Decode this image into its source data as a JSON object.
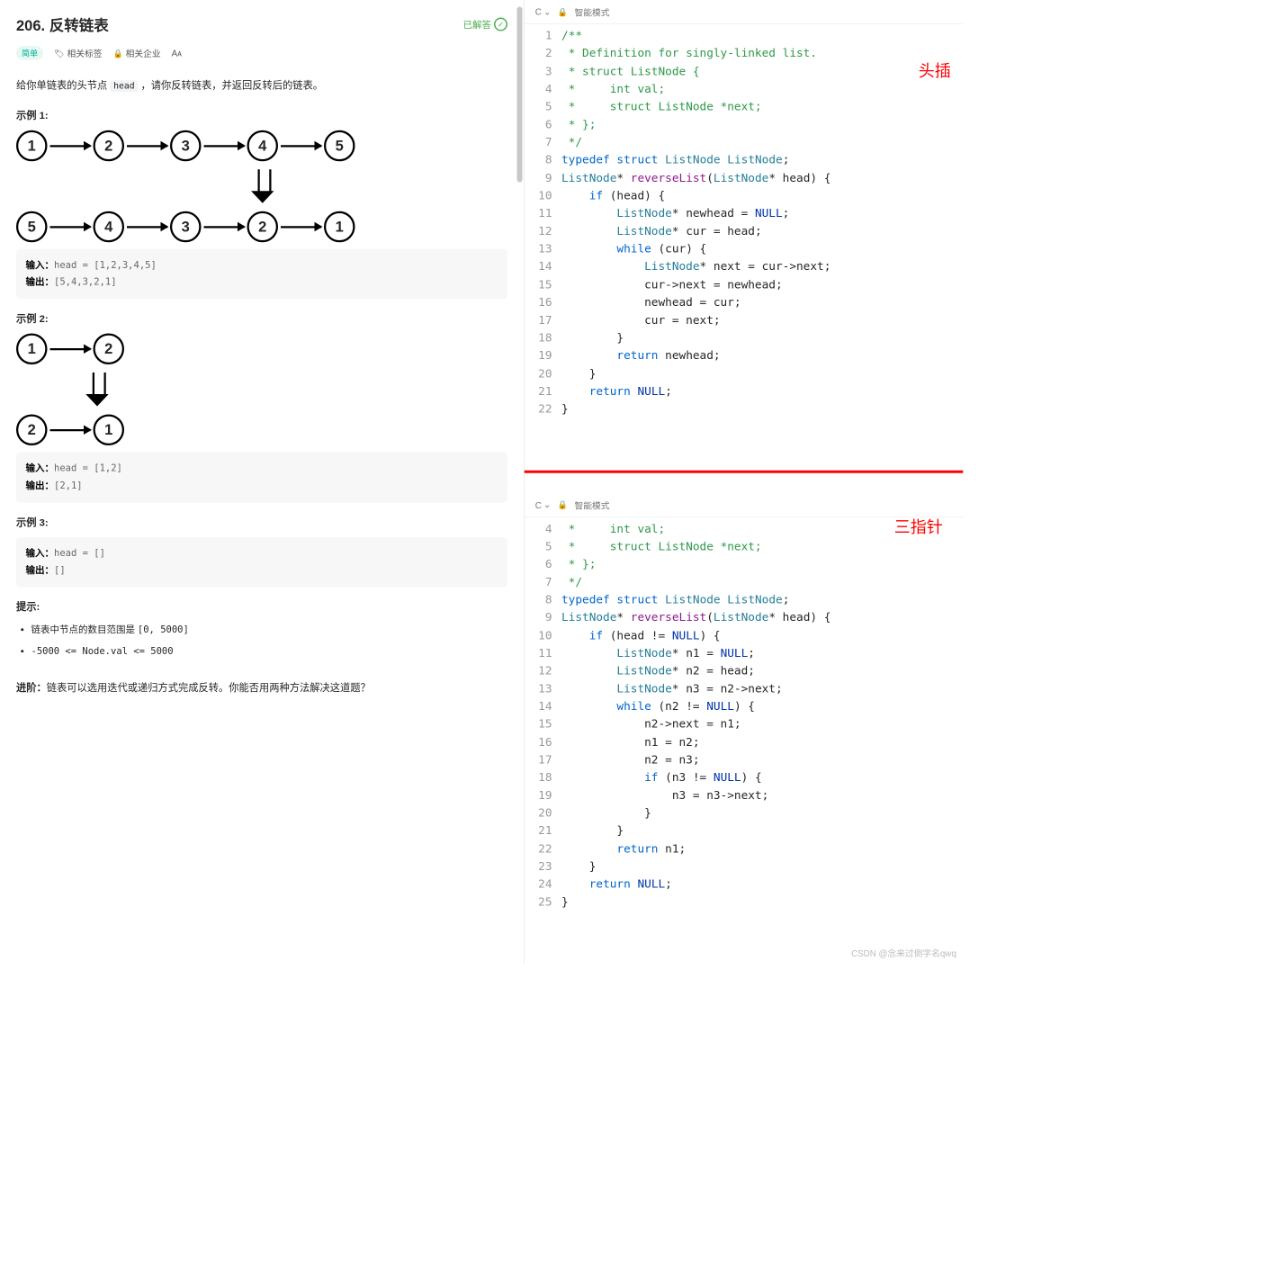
{
  "problem": {
    "number": "206",
    "title": "反转链表",
    "solved": "已解答",
    "difficulty": "简单",
    "tags_label": "相关标签",
    "companies_label": "相关企业",
    "font_icon": "Aᴀ",
    "description_pre": "给你单链表的头节点 ",
    "description_code": "head",
    "description_post": " ，请你反转链表，并返回反转后的链表。"
  },
  "examples": [
    {
      "title": "示例 1:",
      "diagram": {
        "before": [
          "1",
          "2",
          "3",
          "4",
          "5"
        ],
        "after": [
          "5",
          "4",
          "3",
          "2",
          "1"
        ],
        "arrow_offset": "350px"
      },
      "input_label": "输入：",
      "input_val": "head = [1,2,3,4,5]",
      "output_label": "输出：",
      "output_val": "[5,4,3,2,1]"
    },
    {
      "title": "示例 2:",
      "diagram": {
        "before": [
          "1",
          "2"
        ],
        "after": [
          "2",
          "1"
        ],
        "arrow_offset": "105px"
      },
      "input_label": "输入：",
      "input_val": "head = [1,2]",
      "output_label": "输出：",
      "output_val": "[2,1]"
    },
    {
      "title": "示例 3:",
      "input_label": "输入：",
      "input_val": "head = []",
      "output_label": "输出：",
      "output_val": "[]"
    }
  ],
  "hints": {
    "title": "提示:",
    "item1_pre": "链表中节点的数目范围是 ",
    "item1_code": "[0, 5000]",
    "item2_code": "-5000 <= Node.val <= 5000"
  },
  "advance": {
    "label": "进阶：",
    "text": "链表可以选用迭代或递归方式完成反转。你能否用两种方法解决这道题？"
  },
  "editor1": {
    "lang": "C",
    "mode": "智能模式",
    "annotation": "头插",
    "start_line": 1,
    "lines": [
      {
        "n": 1,
        "html": "<span class='tok-cmt'>/**</span>"
      },
      {
        "n": 2,
        "html": "<span class='tok-cmt'> * Definition for singly-linked list.</span>"
      },
      {
        "n": 3,
        "html": "<span class='tok-cmt'> * struct ListNode {</span>"
      },
      {
        "n": 4,
        "html": "<span class='tok-cmt'> *     int val;</span>"
      },
      {
        "n": 5,
        "html": "<span class='tok-cmt'> *     struct ListNode *next;</span>"
      },
      {
        "n": 6,
        "html": "<span class='tok-cmt'> * };</span>"
      },
      {
        "n": 7,
        "html": "<span class='tok-cmt'> */</span>"
      },
      {
        "n": 8,
        "html": "<span class='tok-kw'>typedef</span> <span class='tok-kw'>struct</span> <span class='tok-type'>ListNode</span> <span class='tok-type'>ListNode</span>;"
      },
      {
        "n": 9,
        "html": "<span class='tok-type'>ListNode</span>* <span class='tok-fn'>reverseList</span>(<span class='tok-type'>ListNode</span>* head) {"
      },
      {
        "n": 10,
        "html": "    <span class='tok-kw'>if</span> (head) {"
      },
      {
        "n": 11,
        "html": "        <span class='tok-type'>ListNode</span>* newhead = <span class='tok-const'>NULL</span>;"
      },
      {
        "n": 12,
        "html": "        <span class='tok-type'>ListNode</span>* cur = head;"
      },
      {
        "n": 13,
        "html": "        <span class='tok-kw'>while</span> (cur) {"
      },
      {
        "n": 14,
        "html": "            <span class='tok-type'>ListNode</span>* next = cur-&gt;next;"
      },
      {
        "n": 15,
        "html": "            cur-&gt;next = newhead;"
      },
      {
        "n": 16,
        "html": "            newhead = cur;"
      },
      {
        "n": 17,
        "html": "            cur = next;"
      },
      {
        "n": 18,
        "html": "        }"
      },
      {
        "n": 19,
        "html": "        <span class='tok-kw'>return</span> newhead;"
      },
      {
        "n": 20,
        "html": "    }"
      },
      {
        "n": 21,
        "html": "    <span class='tok-kw'>return</span> <span class='tok-const'>NULL</span>;"
      },
      {
        "n": 22,
        "html": "}"
      }
    ]
  },
  "editor2": {
    "lang": "C",
    "mode": "智能模式",
    "annotation": "三指针",
    "lines": [
      {
        "n": 4,
        "html": "<span class='tok-cmt'> *     int val;</span>"
      },
      {
        "n": 5,
        "html": "<span class='tok-cmt'> *     struct ListNode *next;</span>"
      },
      {
        "n": 6,
        "html": "<span class='tok-cmt'> * };</span>"
      },
      {
        "n": 7,
        "html": "<span class='tok-cmt'> */</span>"
      },
      {
        "n": 8,
        "html": "<span class='tok-kw'>typedef</span> <span class='tok-kw'>struct</span> <span class='tok-type'>ListNode</span> <span class='tok-type'>ListNode</span>;"
      },
      {
        "n": 9,
        "html": "<span class='tok-type'>ListNode</span>* <span class='tok-fn'>reverseList</span>(<span class='tok-type'>ListNode</span>* head) {"
      },
      {
        "n": 10,
        "html": "    <span class='tok-kw'>if</span> (head != <span class='tok-const'>NULL</span>) {"
      },
      {
        "n": 11,
        "html": "        <span class='tok-type'>ListNode</span>* n1 = <span class='tok-const'>NULL</span>;"
      },
      {
        "n": 12,
        "html": "        <span class='tok-type'>ListNode</span>* n2 = head;"
      },
      {
        "n": 13,
        "html": "        <span class='tok-type'>ListNode</span>* n3 = n2-&gt;next;"
      },
      {
        "n": 14,
        "html": "        <span class='tok-kw'>while</span> (n2 != <span class='tok-const'>NULL</span>) {"
      },
      {
        "n": 15,
        "html": "            n2-&gt;next = n1;"
      },
      {
        "n": 16,
        "html": "            n1 = n2;"
      },
      {
        "n": 17,
        "html": "            n2 = n3;"
      },
      {
        "n": 18,
        "html": "            <span class='tok-kw'>if</span> (n3 != <span class='tok-const'>NULL</span>) {"
      },
      {
        "n": 19,
        "html": "                n3 = n3-&gt;next;"
      },
      {
        "n": 20,
        "html": "            }"
      },
      {
        "n": 21,
        "html": "        }"
      },
      {
        "n": 22,
        "html": "        <span class='tok-kw'>return</span> n1;"
      },
      {
        "n": 23,
        "html": "    }"
      },
      {
        "n": 24,
        "html": "    <span class='tok-kw'>return</span> <span class='tok-const'>NULL</span>;"
      },
      {
        "n": 25,
        "html": "}"
      }
    ]
  },
  "watermark": "CSDN @念来过倒字名qwq"
}
